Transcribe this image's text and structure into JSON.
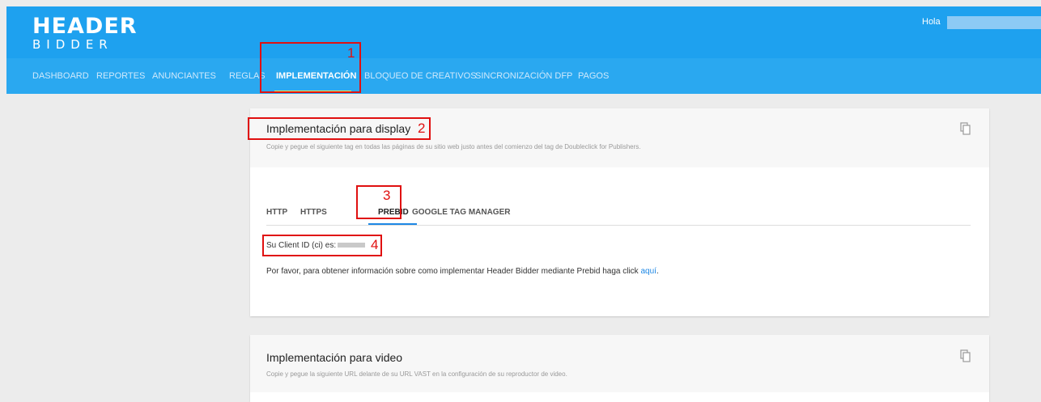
{
  "header": {
    "logo_top": "HEADER",
    "logo_bottom": "BIDDER",
    "greeting": "Hola"
  },
  "nav": {
    "items": [
      {
        "label": "DASHBOARD"
      },
      {
        "label": "REPORTES"
      },
      {
        "label": "ANUNCIANTES"
      },
      {
        "label": "REGLAS"
      },
      {
        "label": "IMPLEMENTACIÓN"
      },
      {
        "label": "BLOQUEO DE CREATIVOS"
      },
      {
        "label": "SINCRONIZACIÓN DFP"
      },
      {
        "label": "PAGOS"
      }
    ],
    "active": "IMPLEMENTACIÓN"
  },
  "annotations": [
    "1",
    "2",
    "3",
    "4"
  ],
  "display_card": {
    "title": "Implementación para display",
    "subtitle": "Copie y pegue el siguiente tag en todas las páginas de su sitio web justo antes del comienzo del tag de Doubleclick for Publishers.",
    "tabs": [
      {
        "label": "HTTP"
      },
      {
        "label": "HTTPS"
      },
      {
        "label": "PREBID"
      },
      {
        "label": "GOOGLE TAG MANAGER"
      }
    ],
    "active_tab": "PREBID",
    "client_id_label": "Su Client ID (ci) es:",
    "info_text": "Por favor, para obtener información sobre como implementar Header Bidder mediante Prebid haga click",
    "info_link": "aquí",
    "info_end": "."
  },
  "video_card": {
    "title": "Implementación para video",
    "subtitle": "Copie y pegue la siguiente URL delante de su URL VAST en la configuración de su reproductor de video."
  },
  "colors": {
    "header_bg": "#1ea1ef",
    "nav_bg": "#2aa8f0",
    "active_underline": "#e8e85a",
    "annotation": "#e01010",
    "link": "#1e88e5"
  },
  "icons": [
    "copy-icon"
  ]
}
